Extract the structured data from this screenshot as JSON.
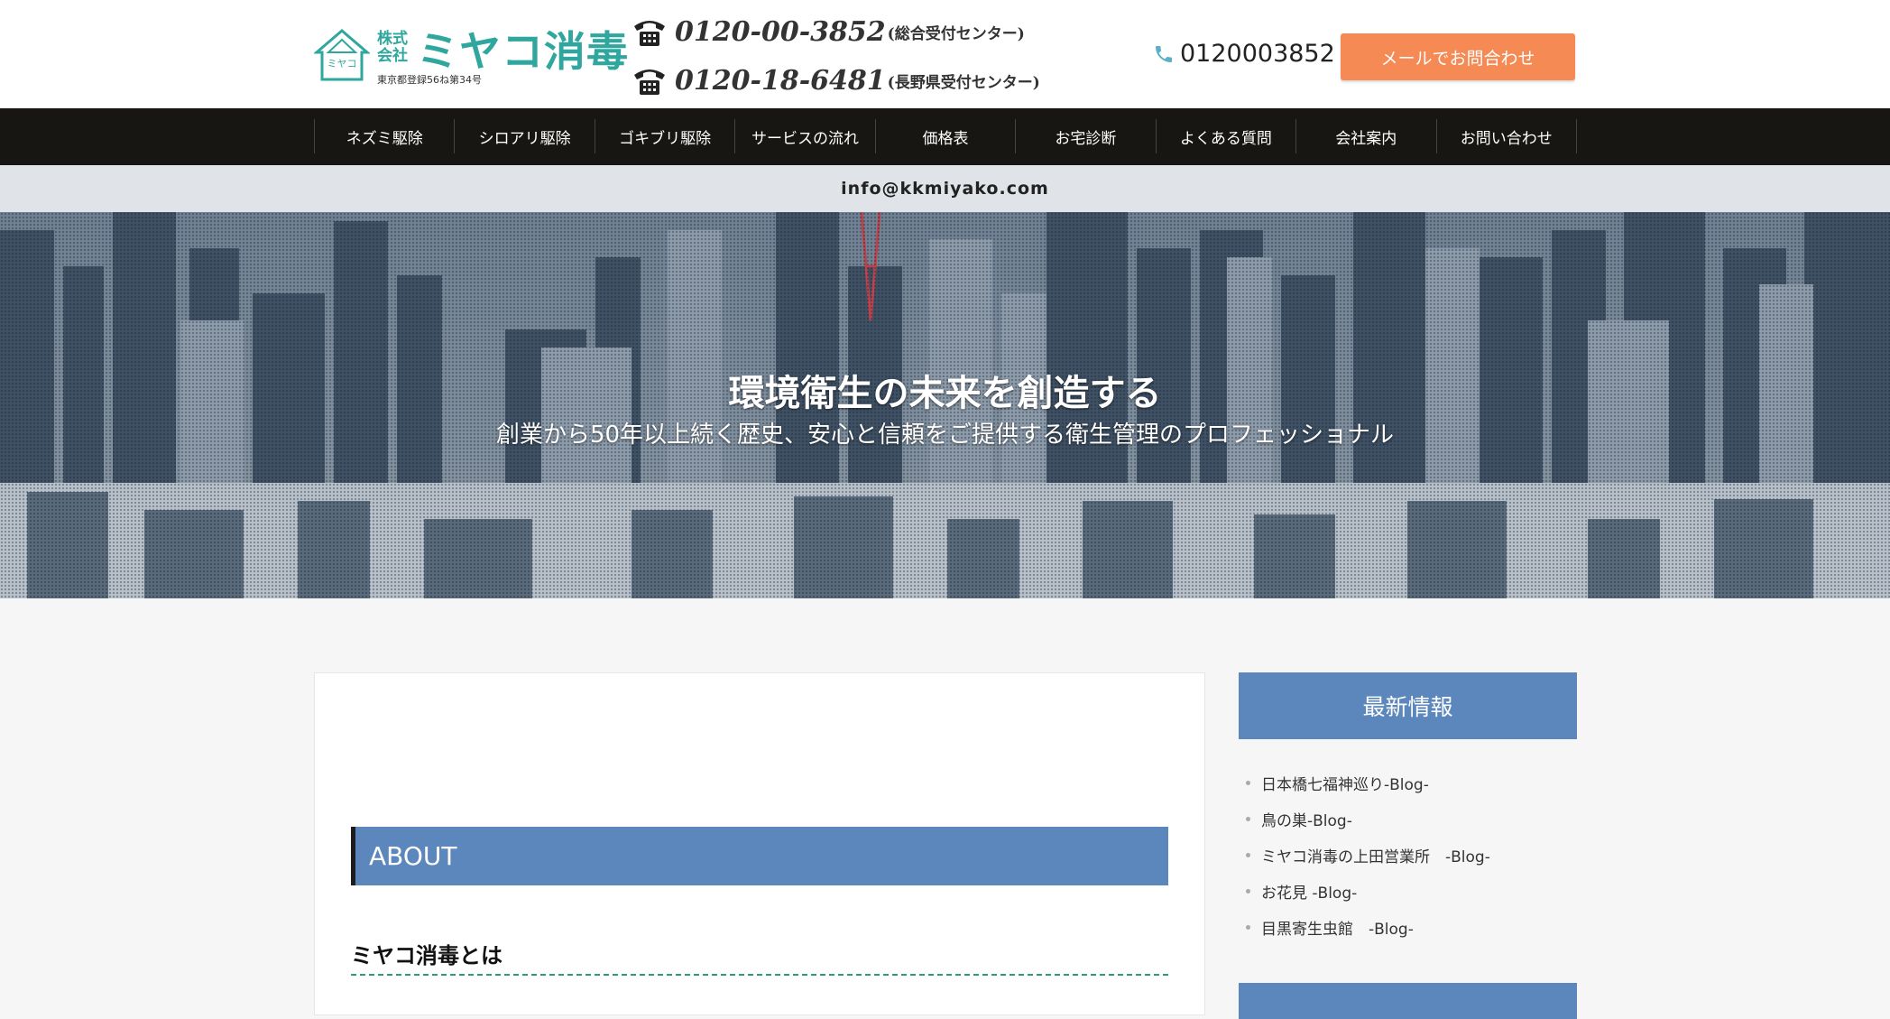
{
  "header": {
    "logo": {
      "mark_text": "ミヤコ",
      "kaisha": "株式会社",
      "name": "ミヤコ消毒",
      "registration": "東京都登録56ね第34号"
    },
    "phones": [
      {
        "number": "0120-00-3852",
        "note": "(総合受付センター)"
      },
      {
        "number": "0120-18-6481",
        "note": "(長野県受付センター)"
      }
    ],
    "tel_link": "0120003852",
    "mail_button": "メールでお問合わせ"
  },
  "nav": {
    "items": [
      "ネズミ駆除",
      "シロアリ駆除",
      "ゴキブリ駆除",
      "サービスの流れ",
      "価格表",
      "お宅診断",
      "よくある質問",
      "会社案内",
      "お問い合わせ"
    ]
  },
  "email_bar": "info@kkmiyako.com",
  "hero": {
    "title": "環境衛生の未来を創造する",
    "subtitle": "創業から50年以上続く歴史、安心と信頼をご提供する衛生管理のプロフェッショナル"
  },
  "main": {
    "about_heading": "ABOUT",
    "about_subheading": "ミヤコ消毒とは"
  },
  "sidebar": {
    "news_heading": "最新情報",
    "news_items": [
      "日本橋七福神巡り-Blog-",
      "鳥の巣-Blog-",
      "ミヤコ消毒の上田営業所　-Blog-",
      "お花見 -Blog-",
      "目黒寄生虫館　-Blog-"
    ]
  },
  "colors": {
    "brand_teal": "#2fa79e",
    "accent_orange": "#f58a55",
    "nav_bg": "#181612",
    "heading_blue": "#5b87bd"
  },
  "icons": {
    "phone": "telephone-icon",
    "tel": "phone-handset-icon"
  }
}
